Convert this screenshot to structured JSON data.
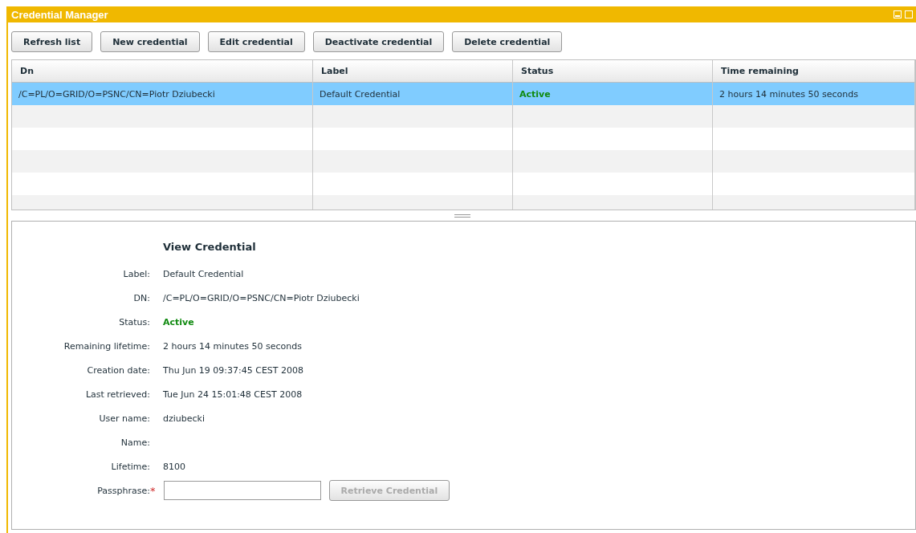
{
  "window": {
    "title": "Credential Manager"
  },
  "toolbar": [
    "Refresh list",
    "New credential",
    "Edit credential",
    "Deactivate credential",
    "Delete credential"
  ],
  "table": {
    "columns": [
      "Dn",
      "Label",
      "Status",
      "Time remaining"
    ],
    "rows": [
      {
        "selected": true,
        "active": true,
        "cells": [
          "/C=PL/O=GRID/O=PSNC/CN=Piotr Dziubecki",
          "Default Credential",
          "Active",
          "2 hours 14 minutes 50 seconds"
        ]
      }
    ]
  },
  "details": {
    "title": "View Credential",
    "fields": [
      {
        "label": "Label:",
        "value": "Default Credential"
      },
      {
        "label": "DN:",
        "value": "/C=PL/O=GRID/O=PSNC/CN=Piotr Dziubecki"
      },
      {
        "label": "Status:",
        "value": "Active",
        "active": true
      },
      {
        "label": "Remaining lifetime:",
        "value": "2 hours 14 minutes 50 seconds"
      },
      {
        "label": "Creation date:",
        "value": "Thu Jun 19 09:37:45 CEST 2008"
      },
      {
        "label": "Last retrieved:",
        "value": "Tue Jun 24 15:01:48 CEST 2008"
      },
      {
        "label": "User name:",
        "value": "dziubecki"
      },
      {
        "label": "Name:"
      },
      {
        "label": "Lifetime:",
        "value": "8100"
      }
    ],
    "passphrase": {
      "label": "Passphrase:",
      "required_mark": "*"
    },
    "retrieve_button": {
      "label": "Retrieve Credential",
      "disabled": true
    }
  }
}
